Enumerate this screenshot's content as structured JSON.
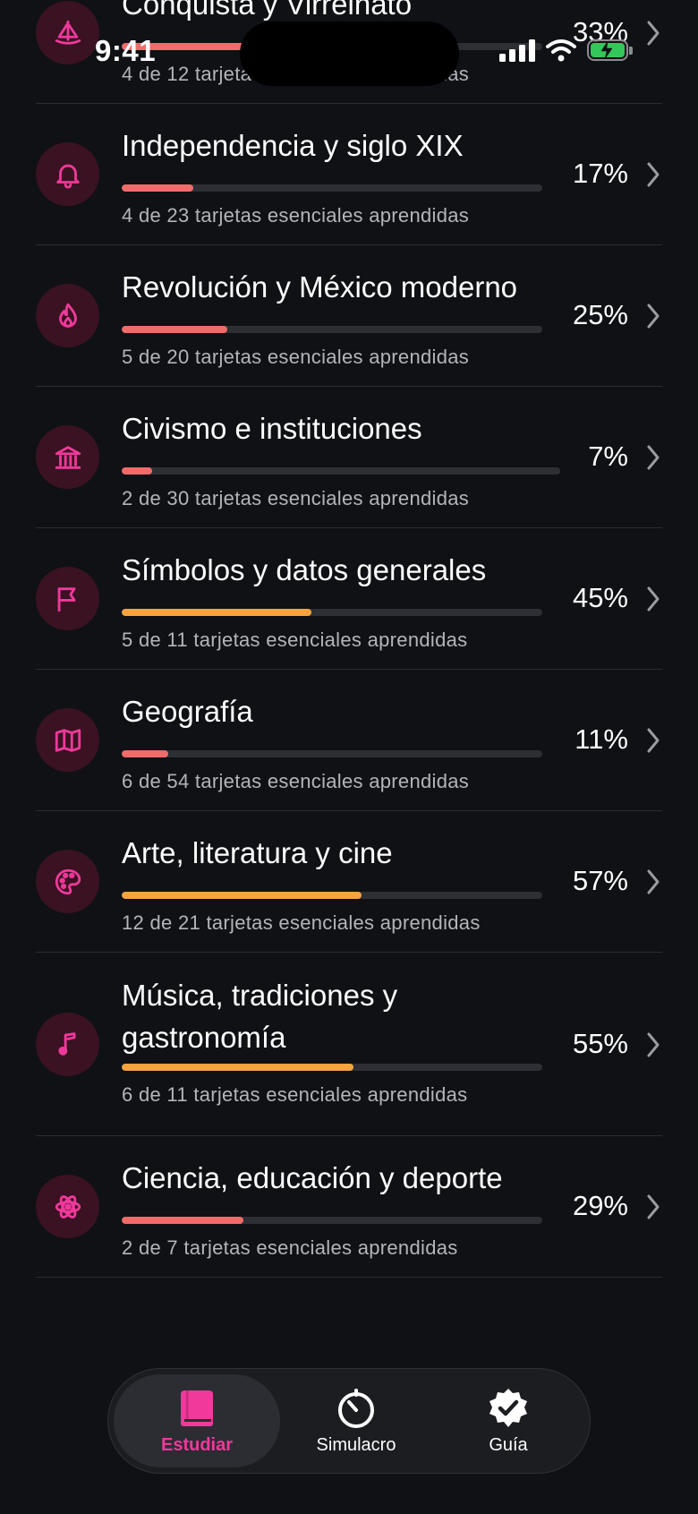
{
  "status_bar": {
    "time": "9:41"
  },
  "colors": {
    "background": "#0f1115",
    "accent": "#f0399a",
    "progress_low": "#f26b6b",
    "progress_mid": "#f7a440",
    "divider": "#2a2c31",
    "battery": "#34c759"
  },
  "topics": [
    {
      "title": "Conquista y Virreinato",
      "subtitle": "4 de 12 tarjetas esenciales aprendidas",
      "percent_label": "33%",
      "progress": 0.33,
      "icon": "sailboat-icon"
    },
    {
      "title": "Independencia y siglo XIX",
      "subtitle": "4 de 23 tarjetas esenciales aprendidas",
      "percent_label": "17%",
      "progress": 0.17,
      "icon": "bell-icon"
    },
    {
      "title": "Revolución y México moderno",
      "subtitle": "5 de 20 tarjetas esenciales aprendidas",
      "percent_label": "25%",
      "progress": 0.25,
      "icon": "flame-icon"
    },
    {
      "title": "Civismo e instituciones",
      "subtitle": "2 de 30 tarjetas esenciales aprendidas",
      "percent_label": "7%",
      "progress": 0.07,
      "icon": "institution-icon"
    },
    {
      "title": "Símbolos y datos generales",
      "subtitle": "5 de 11 tarjetas esenciales aprendidas",
      "percent_label": "45%",
      "progress": 0.45,
      "icon": "flag-icon"
    },
    {
      "title": "Geografía",
      "subtitle": "6 de 54 tarjetas esenciales aprendidas",
      "percent_label": "11%",
      "progress": 0.11,
      "icon": "map-icon"
    },
    {
      "title": "Arte, literatura y cine",
      "subtitle": "12 de 21 tarjetas esenciales aprendidas",
      "percent_label": "57%",
      "progress": 0.57,
      "icon": "palette-icon"
    },
    {
      "title": "Música, tradiciones y gastronomía",
      "subtitle": "6 de 11 tarjetas esenciales aprendidas",
      "percent_label": "55%",
      "progress": 0.55,
      "icon": "music-note-icon"
    },
    {
      "title": "Ciencia, educación y deporte",
      "subtitle": "2 de 7 tarjetas esenciales aprendidas",
      "percent_label": "29%",
      "progress": 0.29,
      "icon": "atom-icon"
    }
  ],
  "tab_bar": {
    "items": [
      {
        "label": "Estudiar",
        "icon": "book-icon",
        "active": true
      },
      {
        "label": "Simulacro",
        "icon": "timer-icon",
        "active": false
      },
      {
        "label": "Guía",
        "icon": "verified-badge-icon",
        "active": false
      }
    ]
  }
}
